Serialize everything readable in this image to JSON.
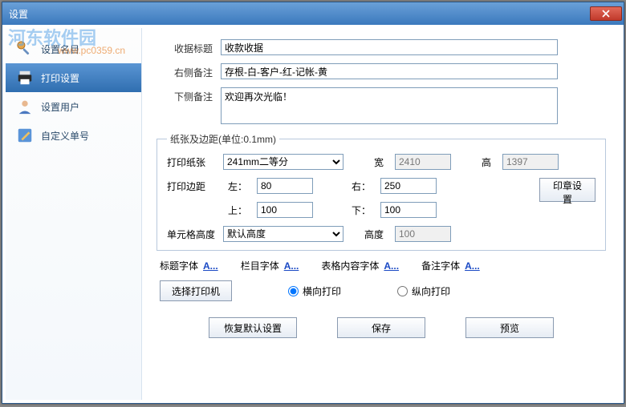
{
  "window": {
    "title": "设置"
  },
  "watermark": {
    "text": "河东软件园",
    "url": "www.pc0359.cn"
  },
  "sidebar": {
    "items": [
      {
        "label": "设置名目"
      },
      {
        "label": "打印设置"
      },
      {
        "label": "设置用户"
      },
      {
        "label": "自定义单号"
      }
    ]
  },
  "form": {
    "receipt_title_label": "收据标题",
    "receipt_title_value": "收款收据",
    "right_note_label": "右侧备注",
    "right_note_value": "存根-白-客户-红-记帐-黄",
    "bottom_note_label": "下侧备注",
    "bottom_note_value": "欢迎再次光临！"
  },
  "paper": {
    "legend": "纸张及边距(单位:0.1mm)",
    "paper_label": "打印纸张",
    "paper_value": "241mm二等分",
    "width_label": "宽",
    "width_value": "2410",
    "height_label": "高",
    "height_value": "1397",
    "margin_label": "打印边距",
    "left_label": "左：",
    "left_value": "80",
    "right_label": "右：",
    "right_value": "250",
    "top_label": "上：",
    "top_value": "100",
    "bottom_label": "下：",
    "bottom_value": "100",
    "stamp_btn": "印章设置",
    "cell_h_label": "单元格高度",
    "cell_h_value": "默认高度",
    "cell_hn_label": "高度",
    "cell_hn_value": "100"
  },
  "fonts": {
    "title": "标题字体",
    "column": "栏目字体",
    "table": "表格内容字体",
    "remark": "备注字体",
    "link": "A..."
  },
  "printer": {
    "select_btn": "选择打印机",
    "landscape": "横向打印",
    "portrait": "纵向打印"
  },
  "bottom": {
    "restore": "恢复默认设置",
    "save": "保存",
    "preview": "预览"
  }
}
